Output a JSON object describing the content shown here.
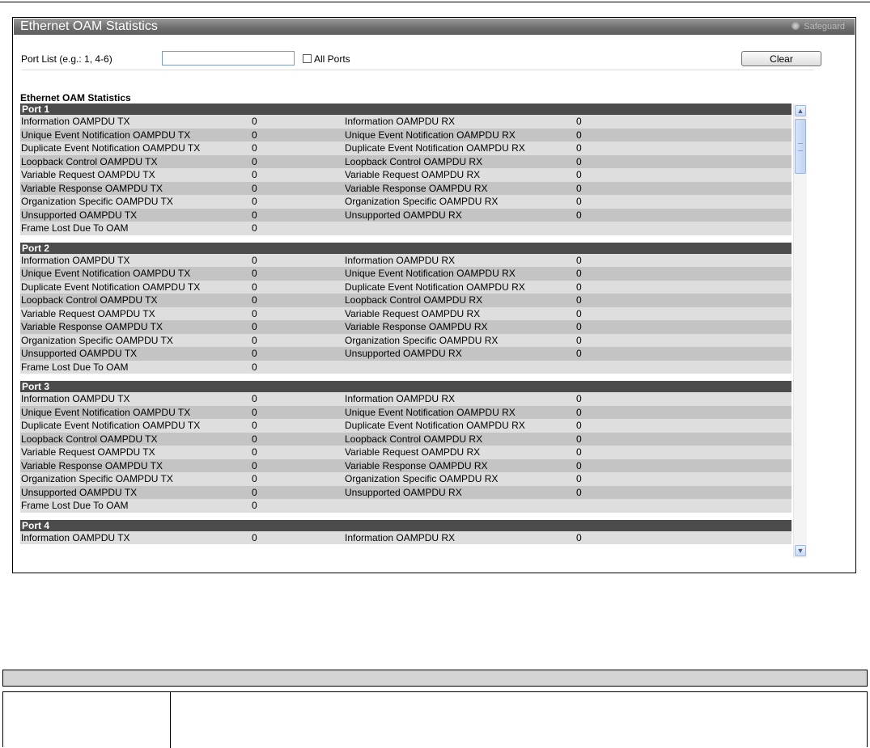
{
  "window": {
    "title": "Ethernet OAM Statistics",
    "safeguard_label": "Safeguard"
  },
  "form": {
    "port_list_label": "Port List (e.g.: 1, 4-6)",
    "port_list_value": "",
    "all_ports_label": "All Ports",
    "all_ports_checked": false,
    "clear_label": "Clear"
  },
  "section_title": "Ethernet OAM Statistics",
  "ports": [
    {
      "name": "Port 1",
      "rows": [
        {
          "tx_label": "Information OAMPDU TX",
          "tx_value": "0",
          "rx_label": "Information OAMPDU RX",
          "rx_value": "0"
        },
        {
          "tx_label": "Unique Event Notification OAMPDU TX",
          "tx_value": "0",
          "rx_label": "Unique Event Notification OAMPDU RX",
          "rx_value": "0"
        },
        {
          "tx_label": "Duplicate Event Notification OAMPDU TX",
          "tx_value": "0",
          "rx_label": "Duplicate Event Notification OAMPDU RX",
          "rx_value": "0"
        },
        {
          "tx_label": "Loopback Control OAMPDU TX",
          "tx_value": "0",
          "rx_label": "Loopback Control OAMPDU RX",
          "rx_value": "0"
        },
        {
          "tx_label": "Variable Request OAMPDU TX",
          "tx_value": "0",
          "rx_label": "Variable Request OAMPDU RX",
          "rx_value": "0"
        },
        {
          "tx_label": "Variable Response OAMPDU TX",
          "tx_value": "0",
          "rx_label": "Variable Response OAMPDU RX",
          "rx_value": "0"
        },
        {
          "tx_label": "Organization Specific OAMPDU TX",
          "tx_value": "0",
          "rx_label": "Organization Specific OAMPDU RX",
          "rx_value": "0"
        },
        {
          "tx_label": "Unsupported OAMPDU TX",
          "tx_value": "0",
          "rx_label": "Unsupported OAMPDU RX",
          "rx_value": "0"
        },
        {
          "tx_label": "Frame Lost Due To OAM",
          "tx_value": "0",
          "rx_label": "",
          "rx_value": ""
        }
      ]
    },
    {
      "name": "Port 2",
      "rows": [
        {
          "tx_label": "Information OAMPDU TX",
          "tx_value": "0",
          "rx_label": "Information OAMPDU RX",
          "rx_value": "0"
        },
        {
          "tx_label": "Unique Event Notification OAMPDU TX",
          "tx_value": "0",
          "rx_label": "Unique Event Notification OAMPDU RX",
          "rx_value": "0"
        },
        {
          "tx_label": "Duplicate Event Notification OAMPDU TX",
          "tx_value": "0",
          "rx_label": "Duplicate Event Notification OAMPDU RX",
          "rx_value": "0"
        },
        {
          "tx_label": "Loopback Control OAMPDU TX",
          "tx_value": "0",
          "rx_label": "Loopback Control OAMPDU RX",
          "rx_value": "0"
        },
        {
          "tx_label": "Variable Request OAMPDU TX",
          "tx_value": "0",
          "rx_label": "Variable Request OAMPDU RX",
          "rx_value": "0"
        },
        {
          "tx_label": "Variable Response OAMPDU TX",
          "tx_value": "0",
          "rx_label": "Variable Response OAMPDU RX",
          "rx_value": "0"
        },
        {
          "tx_label": "Organization Specific OAMPDU TX",
          "tx_value": "0",
          "rx_label": "Organization Specific OAMPDU RX",
          "rx_value": "0"
        },
        {
          "tx_label": "Unsupported OAMPDU TX",
          "tx_value": "0",
          "rx_label": "Unsupported OAMPDU RX",
          "rx_value": "0"
        },
        {
          "tx_label": "Frame Lost Due To OAM",
          "tx_value": "0",
          "rx_label": "",
          "rx_value": ""
        }
      ]
    },
    {
      "name": "Port 3",
      "rows": [
        {
          "tx_label": "Information OAMPDU TX",
          "tx_value": "0",
          "rx_label": "Information OAMPDU RX",
          "rx_value": "0"
        },
        {
          "tx_label": "Unique Event Notification OAMPDU TX",
          "tx_value": "0",
          "rx_label": "Unique Event Notification OAMPDU RX",
          "rx_value": "0"
        },
        {
          "tx_label": "Duplicate Event Notification OAMPDU TX",
          "tx_value": "0",
          "rx_label": "Duplicate Event Notification OAMPDU RX",
          "rx_value": "0"
        },
        {
          "tx_label": "Loopback Control OAMPDU TX",
          "tx_value": "0",
          "rx_label": "Loopback Control OAMPDU RX",
          "rx_value": "0"
        },
        {
          "tx_label": "Variable Request OAMPDU TX",
          "tx_value": "0",
          "rx_label": "Variable Request OAMPDU RX",
          "rx_value": "0"
        },
        {
          "tx_label": "Variable Response OAMPDU TX",
          "tx_value": "0",
          "rx_label": "Variable Response OAMPDU RX",
          "rx_value": "0"
        },
        {
          "tx_label": "Organization Specific OAMPDU TX",
          "tx_value": "0",
          "rx_label": "Organization Specific OAMPDU RX",
          "rx_value": "0"
        },
        {
          "tx_label": "Unsupported OAMPDU TX",
          "tx_value": "0",
          "rx_label": "Unsupported OAMPDU RX",
          "rx_value": "0"
        },
        {
          "tx_label": "Frame Lost Due To OAM",
          "tx_value": "0",
          "rx_label": "",
          "rx_value": ""
        }
      ]
    },
    {
      "name": "Port 4",
      "rows": [
        {
          "tx_label": "Information OAMPDU TX",
          "tx_value": "0",
          "rx_label": "Information OAMPDU RX",
          "rx_value": "0"
        }
      ]
    }
  ],
  "icons": {
    "safeguard": "status-dot-icon",
    "scroll_up": "scroll-up-arrow-icon",
    "scroll_down": "scroll-down-arrow-icon"
  }
}
